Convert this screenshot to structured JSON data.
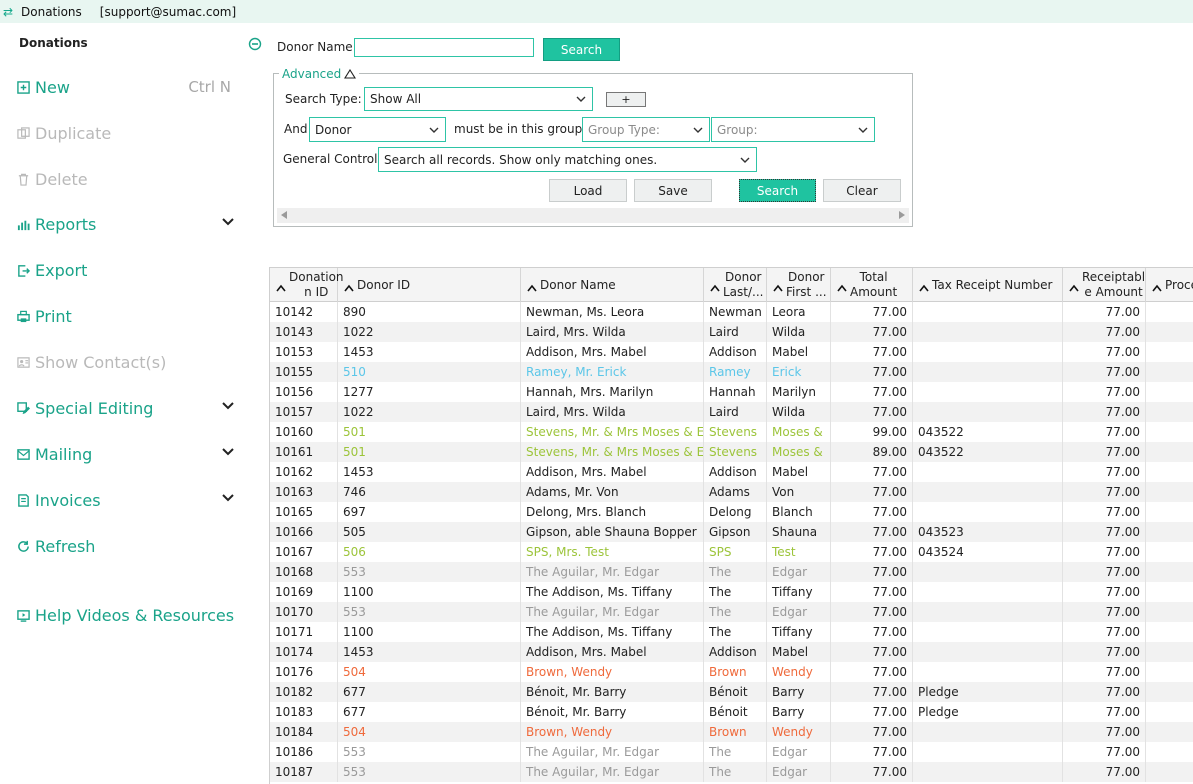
{
  "window": {
    "title": "Donations",
    "user": "[support@sumac.com]"
  },
  "sidebar": {
    "title": "Donations",
    "items": [
      {
        "label": "New",
        "shortcut": "Ctrl N",
        "icon": "plus-square-icon"
      },
      {
        "label": "Duplicate",
        "icon": "duplicate-icon"
      },
      {
        "label": "Delete",
        "icon": "trash-icon"
      },
      {
        "label": "Reports",
        "icon": "bar-chart-icon"
      },
      {
        "label": "Export",
        "icon": "export-icon"
      },
      {
        "label": "Print",
        "icon": "printer-icon"
      },
      {
        "label": "Show Contact(s)",
        "icon": "contacts-icon"
      },
      {
        "label": "Special Editing",
        "icon": "special-edit-icon"
      },
      {
        "label": "Mailing",
        "icon": "mail-icon"
      },
      {
        "label": "Invoices",
        "icon": "invoice-icon"
      },
      {
        "label": "Refresh",
        "icon": "refresh-icon"
      },
      {
        "label": "Help Videos & Resources",
        "icon": "help-video-icon"
      }
    ]
  },
  "search": {
    "donor_name_label": "Donor Name",
    "donor_name_value": "",
    "search_button": "Search",
    "advanced_label": "Advanced",
    "search_type_label": "Search Type:",
    "search_type_value": "Show All",
    "plus_button": "+",
    "and_label": "And",
    "and_value": "Donor",
    "group_label": "must be in this group:",
    "group_type_placeholder": "Group Type:",
    "group_placeholder": "Group:",
    "general_control_label": "General Control:",
    "general_control_value": "Search all records. Show only matching ones.",
    "load_button": "Load",
    "save_button": "Save",
    "search_button2": "Search",
    "clear_button": "Clear"
  },
  "colors": {
    "accent": "#1aa389",
    "button": "#1fc3a0",
    "blue_row": "#5bc6e8",
    "green_row": "#9cc43a",
    "grey_row": "#9a9a9a",
    "orange_row": "#ef6a3c"
  },
  "table": {
    "columns": [
      {
        "label": "Donation ID",
        "line1": "Donation",
        "line2": "n ID"
      },
      {
        "label": "Donor ID"
      },
      {
        "label": "Donor Name"
      },
      {
        "label": "Donor Last/...",
        "line1": "Donor",
        "line2": "Last/..."
      },
      {
        "label": "Donor First ...",
        "line1": "Donor",
        "line2": "First ..."
      },
      {
        "label": "Total Amount",
        "line1": "Total",
        "line2": "Amount"
      },
      {
        "label": "Tax Receipt Number"
      },
      {
        "label": "Receiptable Amount",
        "line1": "Receiptabl",
        "line2": "e Amount"
      },
      {
        "label": "Proce"
      }
    ],
    "rows": [
      {
        "c": "black",
        "v": [
          "10142",
          "890",
          "Newman, Ms. Leora",
          "Newman",
          "Leora",
          "77.00",
          "",
          "77.00"
        ]
      },
      {
        "c": "black",
        "v": [
          "10143",
          "1022",
          "Laird, Mrs. Wilda",
          "Laird",
          "Wilda",
          "77.00",
          "",
          "77.00"
        ]
      },
      {
        "c": "black",
        "v": [
          "10153",
          "1453",
          "Addison, Mrs. Mabel",
          "Addison",
          "Mabel",
          "77.00",
          "",
          "77.00"
        ]
      },
      {
        "c": "blue",
        "v": [
          "10155",
          "510",
          "Ramey, Mr. Erick",
          "Ramey",
          "Erick",
          "77.00",
          "",
          "77.00"
        ]
      },
      {
        "c": "black",
        "v": [
          "10156",
          "1277",
          "Hannah, Mrs. Marilyn",
          "Hannah",
          "Marilyn",
          "77.00",
          "",
          "77.00"
        ]
      },
      {
        "c": "black",
        "v": [
          "10157",
          "1022",
          "Laird, Mrs. Wilda",
          "Laird",
          "Wilda",
          "77.00",
          "",
          "77.00"
        ]
      },
      {
        "c": "green",
        "v": [
          "10160",
          "501",
          "Stevens, Mr. & Mrs Moses & Eli",
          "Stevens",
          "Moses &",
          "99.00",
          "043522",
          "77.00"
        ]
      },
      {
        "c": "green",
        "v": [
          "10161",
          "501",
          "Stevens, Mr. & Mrs Moses & Eli",
          "Stevens",
          "Moses &",
          "89.00",
          "043522",
          "77.00"
        ]
      },
      {
        "c": "black",
        "v": [
          "10162",
          "1453",
          "Addison, Mrs. Mabel",
          "Addison",
          "Mabel",
          "77.00",
          "",
          "77.00"
        ]
      },
      {
        "c": "black",
        "v": [
          "10163",
          "746",
          "Adams, Mr. Von",
          "Adams",
          "Von",
          "77.00",
          "",
          "77.00"
        ]
      },
      {
        "c": "black",
        "v": [
          "10165",
          "697",
          "Delong, Mrs. Blanch",
          "Delong",
          "Blanch",
          "77.00",
          "",
          "77.00"
        ]
      },
      {
        "c": "black",
        "v": [
          "10166",
          "505",
          "Gipson, able Shauna Bopper",
          "Gipson",
          "Shauna",
          "77.00",
          "043523",
          "77.00"
        ]
      },
      {
        "c": "green",
        "v": [
          "10167",
          "506",
          "SPS, Mrs. Test",
          "SPS",
          "Test",
          "77.00",
          "043524",
          "77.00"
        ]
      },
      {
        "c": "grey",
        "v": [
          "10168",
          "553",
          "The Aguilar, Mr. Edgar",
          "The",
          "Edgar",
          "77.00",
          "",
          "77.00"
        ]
      },
      {
        "c": "black",
        "v": [
          "10169",
          "1100",
          "The Addison, Ms. Tiffany",
          "The",
          "Tiffany",
          "77.00",
          "",
          "77.00"
        ]
      },
      {
        "c": "grey",
        "v": [
          "10170",
          "553",
          "The Aguilar, Mr. Edgar",
          "The",
          "Edgar",
          "77.00",
          "",
          "77.00"
        ]
      },
      {
        "c": "black",
        "v": [
          "10171",
          "1100",
          "The Addison, Ms. Tiffany",
          "The",
          "Tiffany",
          "77.00",
          "",
          "77.00"
        ]
      },
      {
        "c": "black",
        "v": [
          "10174",
          "1453",
          "Addison, Mrs. Mabel",
          "Addison",
          "Mabel",
          "77.00",
          "",
          "77.00"
        ]
      },
      {
        "c": "orange",
        "v": [
          "10176",
          "504",
          "Brown, Wendy",
          "Brown",
          "Wendy",
          "77.00",
          "",
          "77.00"
        ]
      },
      {
        "c": "black",
        "v": [
          "10182",
          "677",
          "Bénoit, Mr. Barry",
          "Bénoit",
          "Barry",
          "77.00",
          "Pledge",
          "77.00"
        ]
      },
      {
        "c": "black",
        "v": [
          "10183",
          "677",
          "Bénoit, Mr. Barry",
          "Bénoit",
          "Barry",
          "77.00",
          "Pledge",
          "77.00"
        ]
      },
      {
        "c": "orange",
        "v": [
          "10184",
          "504",
          "Brown, Wendy",
          "Brown",
          "Wendy",
          "77.00",
          "",
          "77.00"
        ]
      },
      {
        "c": "grey",
        "v": [
          "10186",
          "553",
          "The Aguilar, Mr. Edgar",
          "The",
          "Edgar",
          "77.00",
          "",
          "77.00"
        ]
      },
      {
        "c": "grey",
        "v": [
          "10187",
          "553",
          "The Aguilar, Mr. Edgar",
          "The",
          "Edgar",
          "77.00",
          "",
          "77.00"
        ]
      }
    ]
  }
}
